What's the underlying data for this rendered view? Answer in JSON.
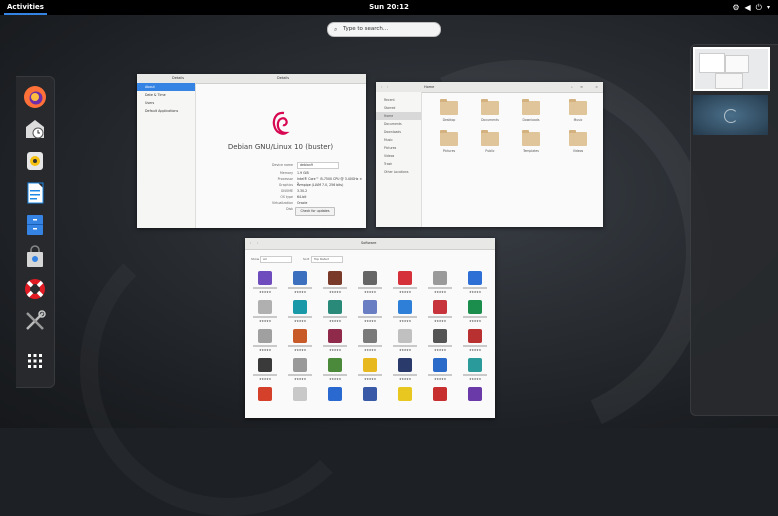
{
  "topbar": {
    "activities_label": "Activities",
    "clock": "Sun 20:12",
    "status_icons": [
      "network-icon",
      "volume-icon",
      "power-icon",
      "menu-arrow-icon"
    ]
  },
  "search": {
    "placeholder": "Type to search…"
  },
  "dash": {
    "apps": [
      {
        "name": "firefox",
        "icon": "firefox-icon",
        "color": "#ff7139"
      },
      {
        "name": "evolution",
        "icon": "mail-clock-icon",
        "color": "#dcdcdc"
      },
      {
        "name": "rhythmbox",
        "icon": "music-player-icon",
        "color": "#f5c211"
      },
      {
        "name": "libreoffice-writer",
        "icon": "writer-document-icon",
        "color": "#1e88e5"
      },
      {
        "name": "files",
        "icon": "file-cabinet-icon",
        "color": "#3584e4"
      },
      {
        "name": "software",
        "icon": "software-bag-icon",
        "color": "#c0c0c0"
      },
      {
        "name": "help",
        "icon": "lifebuoy-icon",
        "color": "#e01b24"
      },
      {
        "name": "settings",
        "icon": "tools-icon",
        "color": "#bbbbbb"
      },
      {
        "name": "show-applications",
        "icon": "app-grid-icon",
        "color": "#ffffff"
      }
    ]
  },
  "windows": {
    "settings": {
      "title": "Details",
      "header_left": "Details",
      "sidebar": [
        "About",
        "Date & Time",
        "Users",
        "Default Applications"
      ],
      "os_name": "Debian GNU/Linux 10 (buster)",
      "details": [
        {
          "k": "Device name",
          "v": "debian9"
        },
        {
          "k": "Memory",
          "v": "1.9 GiB"
        },
        {
          "k": "Processor",
          "v": "Intel® Core™ i5-7500 CPU @ 3.40GHz × 2"
        },
        {
          "k": "Graphics",
          "v": "llvmpipe (LLVM 7.0, 256 bits)"
        },
        {
          "k": "GNOME",
          "v": "3.30.2"
        },
        {
          "k": "OS type",
          "v": "64-bit"
        },
        {
          "k": "Virtualization",
          "v": "Oracle"
        },
        {
          "k": "Disk",
          "v": "21.5 GB"
        }
      ],
      "button": "Check for updates"
    },
    "files": {
      "location": "Home",
      "sidebar": [
        "Recent",
        "Starred",
        "Home",
        "Documents",
        "Downloads",
        "Music",
        "Pictures",
        "Videos",
        "Trash",
        "Other Locations"
      ],
      "folders": [
        "Desktop",
        "Documents",
        "Downloads",
        "Music",
        "Pictures",
        "Public",
        "Templates",
        "Videos"
      ]
    },
    "software": {
      "title": "Software",
      "filter_left": "All",
      "filter_right": "Top Rated",
      "tiles": [
        {
          "color": "#6f4cbd",
          "stars": "★★★★★"
        },
        {
          "color": "#3d6fbf",
          "stars": "★★★★★"
        },
        {
          "color": "#7a3a2a",
          "stars": "★★★★★"
        },
        {
          "color": "#666666",
          "stars": "★★★★★"
        },
        {
          "color": "#d4313a",
          "stars": "★★★★★"
        },
        {
          "color": "#9a9a9a",
          "stars": "★★★★★"
        },
        {
          "color": "#2e6fd6",
          "stars": "★★★★★"
        },
        {
          "color": "#b0b0b0",
          "stars": "★★★★★"
        },
        {
          "color": "#1a9aa8",
          "stars": "★★★★★"
        },
        {
          "color": "#2a8a7a",
          "stars": "★★★★★"
        },
        {
          "color": "#6a7ec4",
          "stars": "★★★★★"
        },
        {
          "color": "#2d7fd8",
          "stars": "★★★★★"
        },
        {
          "color": "#c7343c",
          "stars": "★★★★★"
        },
        {
          "color": "#1b8e4d",
          "stars": "★★★★★"
        },
        {
          "color": "#a0a0a0",
          "stars": "★★★★★"
        },
        {
          "color": "#c85a2a",
          "stars": "★★★★★"
        },
        {
          "color": "#8f2a4a",
          "stars": "★★★★★"
        },
        {
          "color": "#7a7a7a",
          "stars": "★★★★★"
        },
        {
          "color": "#c0c0c0",
          "stars": "★★★★★"
        },
        {
          "color": "#555555",
          "stars": "★★★★★"
        },
        {
          "color": "#b83030",
          "stars": "★★★★★"
        },
        {
          "color": "#3a3a3a",
          "stars": "★★★★★"
        },
        {
          "color": "#999999",
          "stars": "★★★★★"
        },
        {
          "color": "#4a8a3a",
          "stars": "★★★★★"
        },
        {
          "color": "#e8b820",
          "stars": "★★★★★"
        },
        {
          "color": "#2a3a6a",
          "stars": "★★★★★"
        },
        {
          "color": "#2a6ac8",
          "stars": "★★★★★"
        },
        {
          "color": "#2a9a9a",
          "stars": "★★★★★"
        },
        {
          "color": "#d4402a",
          "stars": ""
        },
        {
          "color": "#c8c8c8",
          "stars": ""
        },
        {
          "color": "#2a6ad0",
          "stars": ""
        },
        {
          "color": "#3a5aa8",
          "stars": ""
        },
        {
          "color": "#e8c820",
          "stars": ""
        },
        {
          "color": "#c83030",
          "stars": ""
        },
        {
          "color": "#6a3aa8",
          "stars": ""
        }
      ]
    }
  },
  "workspaces": [
    {
      "label": "",
      "active": true
    },
    {
      "label": "",
      "active": false
    }
  ]
}
